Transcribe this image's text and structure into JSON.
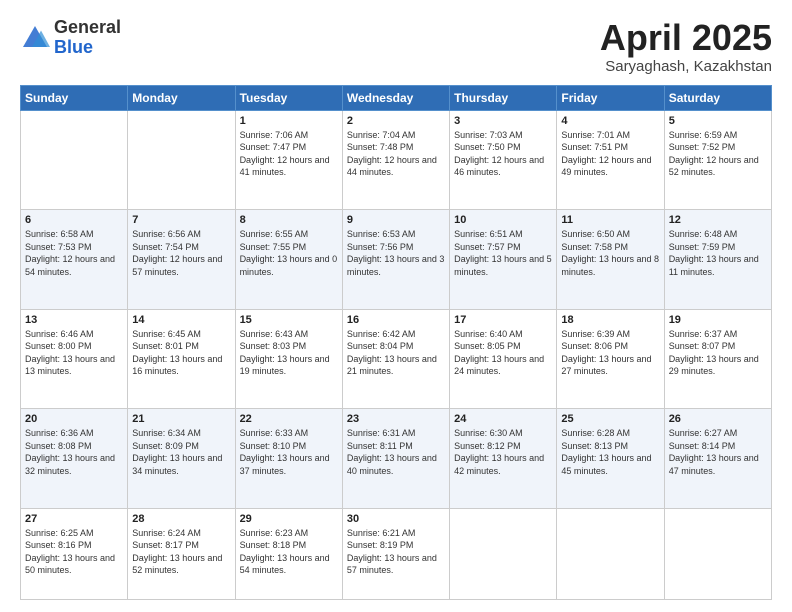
{
  "logo": {
    "general": "General",
    "blue": "Blue"
  },
  "title": "April 2025",
  "subtitle": "Saryaghash, Kazakhstan",
  "days_of_week": [
    "Sunday",
    "Monday",
    "Tuesday",
    "Wednesday",
    "Thursday",
    "Friday",
    "Saturday"
  ],
  "weeks": [
    [
      {
        "day": "",
        "sunrise": "",
        "sunset": "",
        "daylight": ""
      },
      {
        "day": "",
        "sunrise": "",
        "sunset": "",
        "daylight": ""
      },
      {
        "day": "1",
        "sunrise": "Sunrise: 7:06 AM",
        "sunset": "Sunset: 7:47 PM",
        "daylight": "Daylight: 12 hours and 41 minutes."
      },
      {
        "day": "2",
        "sunrise": "Sunrise: 7:04 AM",
        "sunset": "Sunset: 7:48 PM",
        "daylight": "Daylight: 12 hours and 44 minutes."
      },
      {
        "day": "3",
        "sunrise": "Sunrise: 7:03 AM",
        "sunset": "Sunset: 7:50 PM",
        "daylight": "Daylight: 12 hours and 46 minutes."
      },
      {
        "day": "4",
        "sunrise": "Sunrise: 7:01 AM",
        "sunset": "Sunset: 7:51 PM",
        "daylight": "Daylight: 12 hours and 49 minutes."
      },
      {
        "day": "5",
        "sunrise": "Sunrise: 6:59 AM",
        "sunset": "Sunset: 7:52 PM",
        "daylight": "Daylight: 12 hours and 52 minutes."
      }
    ],
    [
      {
        "day": "6",
        "sunrise": "Sunrise: 6:58 AM",
        "sunset": "Sunset: 7:53 PM",
        "daylight": "Daylight: 12 hours and 54 minutes."
      },
      {
        "day": "7",
        "sunrise": "Sunrise: 6:56 AM",
        "sunset": "Sunset: 7:54 PM",
        "daylight": "Daylight: 12 hours and 57 minutes."
      },
      {
        "day": "8",
        "sunrise": "Sunrise: 6:55 AM",
        "sunset": "Sunset: 7:55 PM",
        "daylight": "Daylight: 13 hours and 0 minutes."
      },
      {
        "day": "9",
        "sunrise": "Sunrise: 6:53 AM",
        "sunset": "Sunset: 7:56 PM",
        "daylight": "Daylight: 13 hours and 3 minutes."
      },
      {
        "day": "10",
        "sunrise": "Sunrise: 6:51 AM",
        "sunset": "Sunset: 7:57 PM",
        "daylight": "Daylight: 13 hours and 5 minutes."
      },
      {
        "day": "11",
        "sunrise": "Sunrise: 6:50 AM",
        "sunset": "Sunset: 7:58 PM",
        "daylight": "Daylight: 13 hours and 8 minutes."
      },
      {
        "day": "12",
        "sunrise": "Sunrise: 6:48 AM",
        "sunset": "Sunset: 7:59 PM",
        "daylight": "Daylight: 13 hours and 11 minutes."
      }
    ],
    [
      {
        "day": "13",
        "sunrise": "Sunrise: 6:46 AM",
        "sunset": "Sunset: 8:00 PM",
        "daylight": "Daylight: 13 hours and 13 minutes."
      },
      {
        "day": "14",
        "sunrise": "Sunrise: 6:45 AM",
        "sunset": "Sunset: 8:01 PM",
        "daylight": "Daylight: 13 hours and 16 minutes."
      },
      {
        "day": "15",
        "sunrise": "Sunrise: 6:43 AM",
        "sunset": "Sunset: 8:03 PM",
        "daylight": "Daylight: 13 hours and 19 minutes."
      },
      {
        "day": "16",
        "sunrise": "Sunrise: 6:42 AM",
        "sunset": "Sunset: 8:04 PM",
        "daylight": "Daylight: 13 hours and 21 minutes."
      },
      {
        "day": "17",
        "sunrise": "Sunrise: 6:40 AM",
        "sunset": "Sunset: 8:05 PM",
        "daylight": "Daylight: 13 hours and 24 minutes."
      },
      {
        "day": "18",
        "sunrise": "Sunrise: 6:39 AM",
        "sunset": "Sunset: 8:06 PM",
        "daylight": "Daylight: 13 hours and 27 minutes."
      },
      {
        "day": "19",
        "sunrise": "Sunrise: 6:37 AM",
        "sunset": "Sunset: 8:07 PM",
        "daylight": "Daylight: 13 hours and 29 minutes."
      }
    ],
    [
      {
        "day": "20",
        "sunrise": "Sunrise: 6:36 AM",
        "sunset": "Sunset: 8:08 PM",
        "daylight": "Daylight: 13 hours and 32 minutes."
      },
      {
        "day": "21",
        "sunrise": "Sunrise: 6:34 AM",
        "sunset": "Sunset: 8:09 PM",
        "daylight": "Daylight: 13 hours and 34 minutes."
      },
      {
        "day": "22",
        "sunrise": "Sunrise: 6:33 AM",
        "sunset": "Sunset: 8:10 PM",
        "daylight": "Daylight: 13 hours and 37 minutes."
      },
      {
        "day": "23",
        "sunrise": "Sunrise: 6:31 AM",
        "sunset": "Sunset: 8:11 PM",
        "daylight": "Daylight: 13 hours and 40 minutes."
      },
      {
        "day": "24",
        "sunrise": "Sunrise: 6:30 AM",
        "sunset": "Sunset: 8:12 PM",
        "daylight": "Daylight: 13 hours and 42 minutes."
      },
      {
        "day": "25",
        "sunrise": "Sunrise: 6:28 AM",
        "sunset": "Sunset: 8:13 PM",
        "daylight": "Daylight: 13 hours and 45 minutes."
      },
      {
        "day": "26",
        "sunrise": "Sunrise: 6:27 AM",
        "sunset": "Sunset: 8:14 PM",
        "daylight": "Daylight: 13 hours and 47 minutes."
      }
    ],
    [
      {
        "day": "27",
        "sunrise": "Sunrise: 6:25 AM",
        "sunset": "Sunset: 8:16 PM",
        "daylight": "Daylight: 13 hours and 50 minutes."
      },
      {
        "day": "28",
        "sunrise": "Sunrise: 6:24 AM",
        "sunset": "Sunset: 8:17 PM",
        "daylight": "Daylight: 13 hours and 52 minutes."
      },
      {
        "day": "29",
        "sunrise": "Sunrise: 6:23 AM",
        "sunset": "Sunset: 8:18 PM",
        "daylight": "Daylight: 13 hours and 54 minutes."
      },
      {
        "day": "30",
        "sunrise": "Sunrise: 6:21 AM",
        "sunset": "Sunset: 8:19 PM",
        "daylight": "Daylight: 13 hours and 57 minutes."
      },
      {
        "day": "",
        "sunrise": "",
        "sunset": "",
        "daylight": ""
      },
      {
        "day": "",
        "sunrise": "",
        "sunset": "",
        "daylight": ""
      },
      {
        "day": "",
        "sunrise": "",
        "sunset": "",
        "daylight": ""
      }
    ]
  ]
}
